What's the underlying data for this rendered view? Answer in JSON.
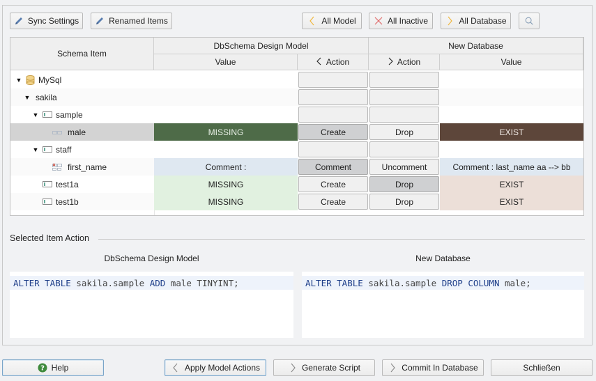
{
  "toolbar": {
    "sync_settings": "Sync Settings",
    "renamed_items": "Renamed Items",
    "all_model": "All Model",
    "all_inactive": "All Inactive",
    "all_database": "All Database",
    "search_icon": "search-icon"
  },
  "table": {
    "headers": {
      "schema_item": "Schema Item",
      "left_group": "DbSchema Design Model",
      "right_group": "New Database",
      "left_value": "Value",
      "left_action": "Action",
      "right_action": "Action",
      "right_value": "Value"
    },
    "rows": [
      {
        "name": "MySql",
        "icon": "database-icon",
        "left_value": "",
        "left_action": "",
        "right_action": "",
        "right_value": ""
      },
      {
        "name": "sakila",
        "icon": "",
        "left_value": "",
        "left_action": "",
        "right_action": "",
        "right_value": ""
      },
      {
        "name": "sample",
        "icon": "table-icon",
        "left_value": "",
        "left_action": "",
        "right_action": "",
        "right_value": ""
      },
      {
        "name": "male",
        "icon": "column-icon",
        "left_value": "MISSING",
        "left_action": "Create",
        "right_action": "Drop",
        "right_value": "EXIST"
      },
      {
        "name": "staff",
        "icon": "table-icon",
        "left_value": "",
        "left_action": "",
        "right_action": "",
        "right_value": ""
      },
      {
        "name": "first_name",
        "icon": "column-icon",
        "left_value": "Comment :",
        "left_action": "Comment",
        "right_action": "Uncomment",
        "right_value": "Comment : last_name aa --> bb"
      },
      {
        "name": "test1a",
        "icon": "table-icon",
        "left_value": "MISSING",
        "left_action": "Create",
        "right_action": "Drop",
        "right_value": "EXIST"
      },
      {
        "name": "test1b",
        "icon": "table-icon",
        "left_value": "MISSING",
        "left_action": "Create",
        "right_action": "Drop",
        "right_value": "EXIST"
      }
    ]
  },
  "colors": {
    "missing_selected": "#4e6b48",
    "exist_selected": "#5d463a",
    "missing": "#e1f1e0",
    "exist": "#ecdfd8",
    "comment": "#dfe8f1"
  },
  "selected_action": {
    "section_label": "Selected Item Action",
    "left_title": "DbSchema Design Model",
    "right_title": "New Database",
    "left_sql": {
      "kw1": "ALTER TABLE",
      "obj": " sakila.sample ",
      "kw2": "ADD",
      "rest": " male TINYINT;"
    },
    "right_sql": {
      "kw1": "ALTER TABLE",
      "obj": " sakila.sample ",
      "kw2": "DROP COLUMN",
      "rest": " male;"
    }
  },
  "footer": {
    "help": "Help",
    "apply_model_actions": "Apply Model Actions",
    "generate_script": "Generate Script",
    "commit_in_database": "Commit In Database",
    "close": "Schließen"
  }
}
